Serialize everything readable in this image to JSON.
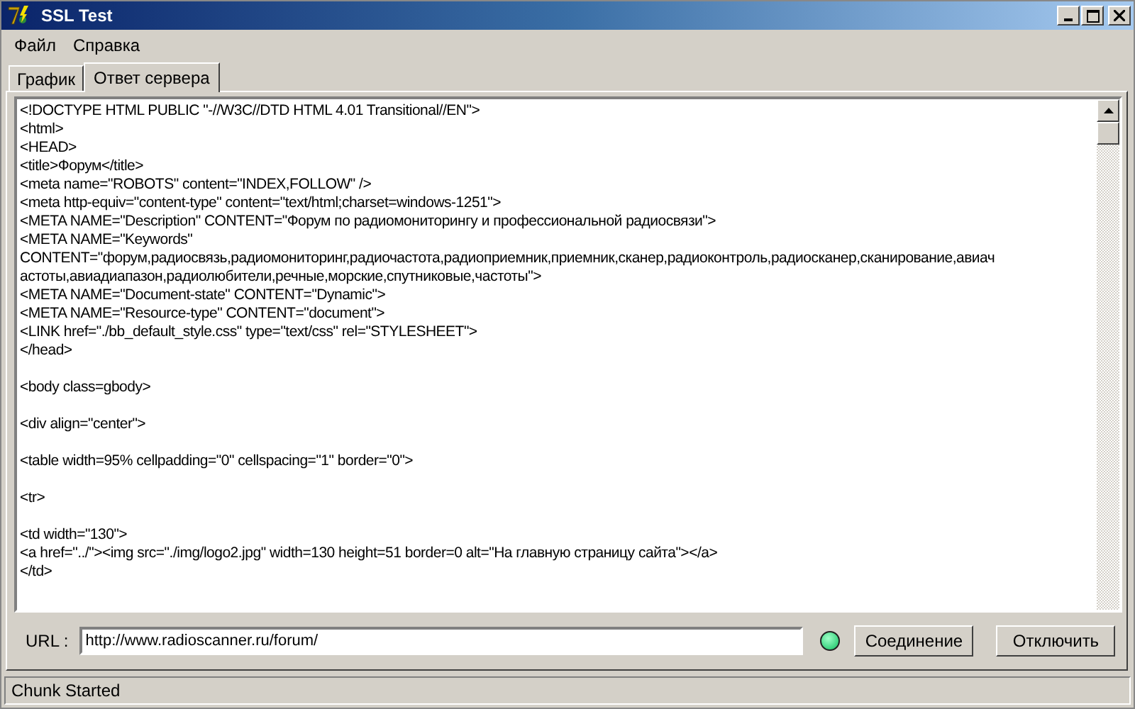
{
  "window": {
    "title": "SSL Test"
  },
  "menu": [
    "Файл",
    "Справка"
  ],
  "tabs": [
    {
      "label": "График",
      "selected": false
    },
    {
      "label": "Ответ сервера",
      "selected": true
    }
  ],
  "response": {
    "blocks": [
      [
        "<!DOCTYPE HTML PUBLIC \"-//W3C//DTD HTML 4.01 Transitional//EN\">",
        "<html>",
        "<HEAD>",
        "<title>Форум</title>",
        "<meta name=\"ROBOTS\" content=\"INDEX,FOLLOW\" />",
        "<meta http-equiv=\"content-type\" content=\"text/html;charset=windows-1251\">",
        "<META NAME=\"Description\" CONTENT=\"Форум по радиомониторингу и профессиональной радиосвязи\">",
        "<META NAME=\"Keywords\"",
        "CONTENT=\"форум,радиосвязь,радиомониторинг,радиочастота,радиоприемник,приемник,сканер,радиоконтроль,радиосканер,сканирование,авиач",
        "астоты,авиадиапазон,радиолюбители,речные,морские,спутниковые,частоты\">",
        "<META NAME=\"Document-state\" CONTENT=\"Dynamic\">",
        "<META NAME=\"Resource-type\" CONTENT=\"document\">",
        "<LINK href=\"./bb_default_style.css\" type=\"text/css\" rel=\"STYLESHEET\">",
        "</head>"
      ],
      [
        "<body class=gbody>"
      ],
      [
        "<div align=\"center\">"
      ],
      [
        "<table width=95% cellpadding=\"0\" cellspacing=\"1\" border=\"0\">"
      ],
      [
        "<tr>"
      ],
      [
        "<td width=\"130\">",
        "<a href=\"../\"><img src=\"./img/logo2.jpg\" width=130 height=51 border=0 alt=\"На главную страницу сайта\"></a>",
        "</td>"
      ]
    ]
  },
  "url": {
    "label": "URL :",
    "value": "http://www.radioscanner.ru/forum/"
  },
  "indicator": {
    "on": true
  },
  "buttons": [
    "Соединение",
    "Отключить"
  ],
  "status_bar": "Chunk Started"
}
